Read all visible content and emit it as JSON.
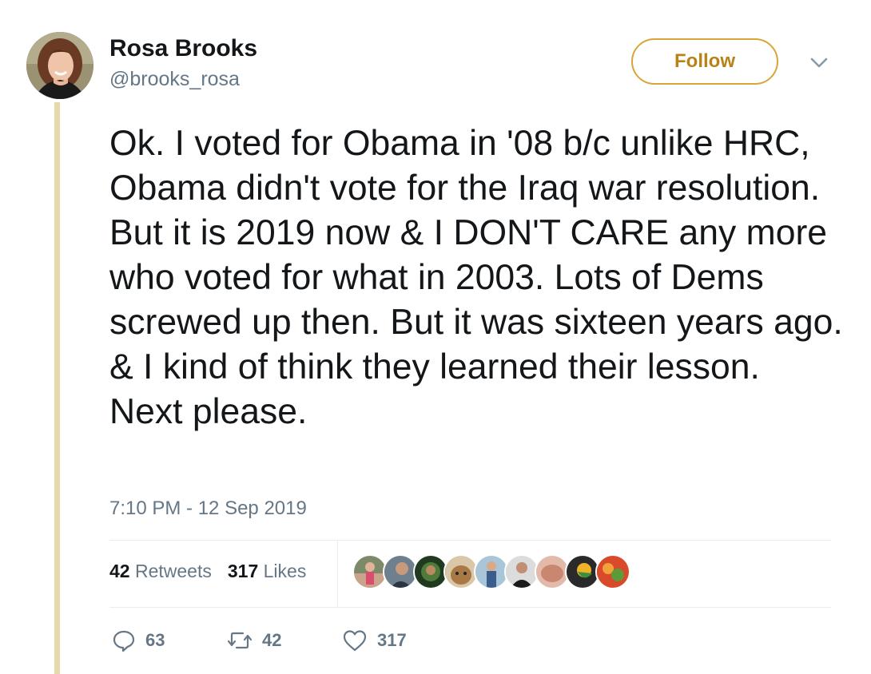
{
  "author": {
    "display_name": "Rosa Brooks",
    "handle": "@brooks_rosa"
  },
  "follow_label": "Follow",
  "tweet": {
    "text": "Ok. I voted for Obama in '08 b/c unlike HRC, Obama didn't vote for the Iraq war resolution. But it is 2019 now & I DON'T CARE any more who voted for what in 2003. Lots of Dems screwed up then. But it was sixteen years ago. & I kind of think they learned their lesson.\nNext please.",
    "timestamp": "7:10 PM - 12 Sep 2019"
  },
  "stats": {
    "retweets_count": "42",
    "retweets_label": "Retweets",
    "likes_count": "317",
    "likes_label": "Likes"
  },
  "actions": {
    "replies": "63",
    "retweets": "42",
    "likes": "317"
  },
  "colors": {
    "accent": "#d9a536",
    "thread_line": "#e8d9ad",
    "muted": "#657786"
  }
}
